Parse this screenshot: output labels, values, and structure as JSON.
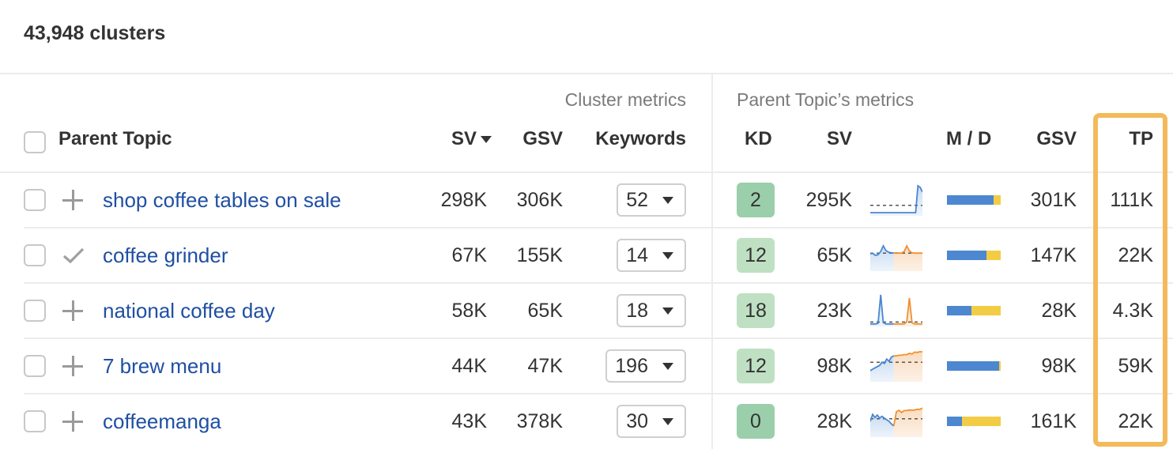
{
  "summary": {
    "cluster_count": "43,948 clusters"
  },
  "groups": {
    "cluster": "Cluster metrics",
    "parent": "Parent Topic’s metrics"
  },
  "headers": {
    "parent_topic": "Parent Topic",
    "sv": "SV",
    "gsv": "GSV",
    "keywords": "Keywords",
    "kd": "KD",
    "pt_sv": "SV",
    "md": "M / D",
    "pt_gsv": "GSV",
    "tp": "TP"
  },
  "sort": {
    "column": "SV",
    "direction": "desc"
  },
  "colors": {
    "link": "#1f4fa3",
    "highlight": "#f3ba5a",
    "mobile": "#4d87d0",
    "desktop": "#f2cc44",
    "kd_very_easy": "#9bcfab",
    "kd_easy": "#bfe0c3",
    "trend_past": "#4a86d0",
    "trend_forecast": "#ef9030"
  },
  "rows": [
    {
      "topic": "shop coffee tables on sale",
      "action_icon": "plus-icon",
      "sv": "298K",
      "gsv": "306K",
      "keywords": "52",
      "kd": "2",
      "kd_level": "very_easy",
      "pt_sv": "295K",
      "mobile_share": 0.87,
      "pt_gsv": "301K",
      "tp": "111K",
      "trend": {
        "past": [
          0.1,
          0.1,
          0.1,
          0.1,
          0.1,
          0.1,
          0.1,
          0.1,
          0.1,
          0.1,
          0.1,
          0.1,
          0.1,
          0.1,
          0.1,
          0.1,
          0.1,
          0.1,
          0.1,
          0.1,
          0.1,
          0.95,
          0.9,
          0.75
        ],
        "forecast": [],
        "baseline": 0.33
      }
    },
    {
      "topic": "coffee grinder",
      "action_icon": "check-icon",
      "sv": "67K",
      "gsv": "155K",
      "keywords": "14",
      "kd": "12",
      "kd_level": "easy",
      "pt_sv": "65K",
      "mobile_share": 0.73,
      "pt_gsv": "147K",
      "tp": "22K",
      "trend": {
        "past": [
          0.55,
          0.56,
          0.5,
          0.52,
          0.62,
          0.8,
          0.65,
          0.6,
          0.58,
          0.57
        ],
        "forecast": [
          0.57,
          0.58,
          0.57,
          0.57,
          0.62,
          0.8,
          0.64,
          0.58,
          0.57,
          0.57,
          0.57,
          0.57
        ],
        "baseline": 0.57
      }
    },
    {
      "topic": "national coffee day",
      "action_icon": "plus-icon",
      "sv": "58K",
      "gsv": "65K",
      "keywords": "18",
      "kd": "18",
      "kd_level": "easy",
      "pt_sv": "23K",
      "mobile_share": 0.46,
      "pt_gsv": "28K",
      "tp": "4.3K",
      "trend": {
        "past": [
          0.08,
          0.08,
          0.08,
          0.1,
          1.0,
          0.12,
          0.08,
          0.08,
          0.08,
          0.08
        ],
        "forecast": [
          0.08,
          0.08,
          0.08,
          0.08,
          0.08,
          0.15,
          0.9,
          0.12,
          0.08,
          0.08,
          0.08,
          0.08
        ],
        "baseline": 0.14
      }
    },
    {
      "topic": "7 brew menu",
      "action_icon": "plus-icon",
      "sv": "44K",
      "gsv": "47K",
      "keywords": "196",
      "kd": "12",
      "kd_level": "easy",
      "pt_sv": "98K",
      "mobile_share": 0.97,
      "pt_gsv": "98K",
      "tp": "59K",
      "trend": {
        "past": [
          0.35,
          0.4,
          0.44,
          0.48,
          0.52,
          0.62,
          0.58,
          0.72,
          0.65,
          0.78,
          0.82
        ],
        "forecast": [
          0.82,
          0.82,
          0.84,
          0.84,
          0.86,
          0.86,
          0.9,
          0.88,
          0.94,
          0.93,
          0.95,
          0.95
        ],
        "baseline": 0.62
      }
    },
    {
      "topic": "coffeemanga",
      "action_icon": "plus-icon",
      "sv": "43K",
      "gsv": "378K",
      "keywords": "30",
      "kd": "0",
      "kd_level": "very_easy",
      "pt_sv": "28K",
      "mobile_share": 0.28,
      "pt_gsv": "161K",
      "tp": "22K",
      "trend": {
        "past": [
          0.5,
          0.72,
          0.62,
          0.7,
          0.6,
          0.66,
          0.6,
          0.55,
          0.5,
          0.42,
          0.35
        ],
        "forecast": [
          0.35,
          0.8,
          0.85,
          0.78,
          0.84,
          0.84,
          0.86,
          0.85,
          0.86,
          0.88,
          0.88,
          0.92
        ],
        "baseline": 0.58
      }
    }
  ]
}
